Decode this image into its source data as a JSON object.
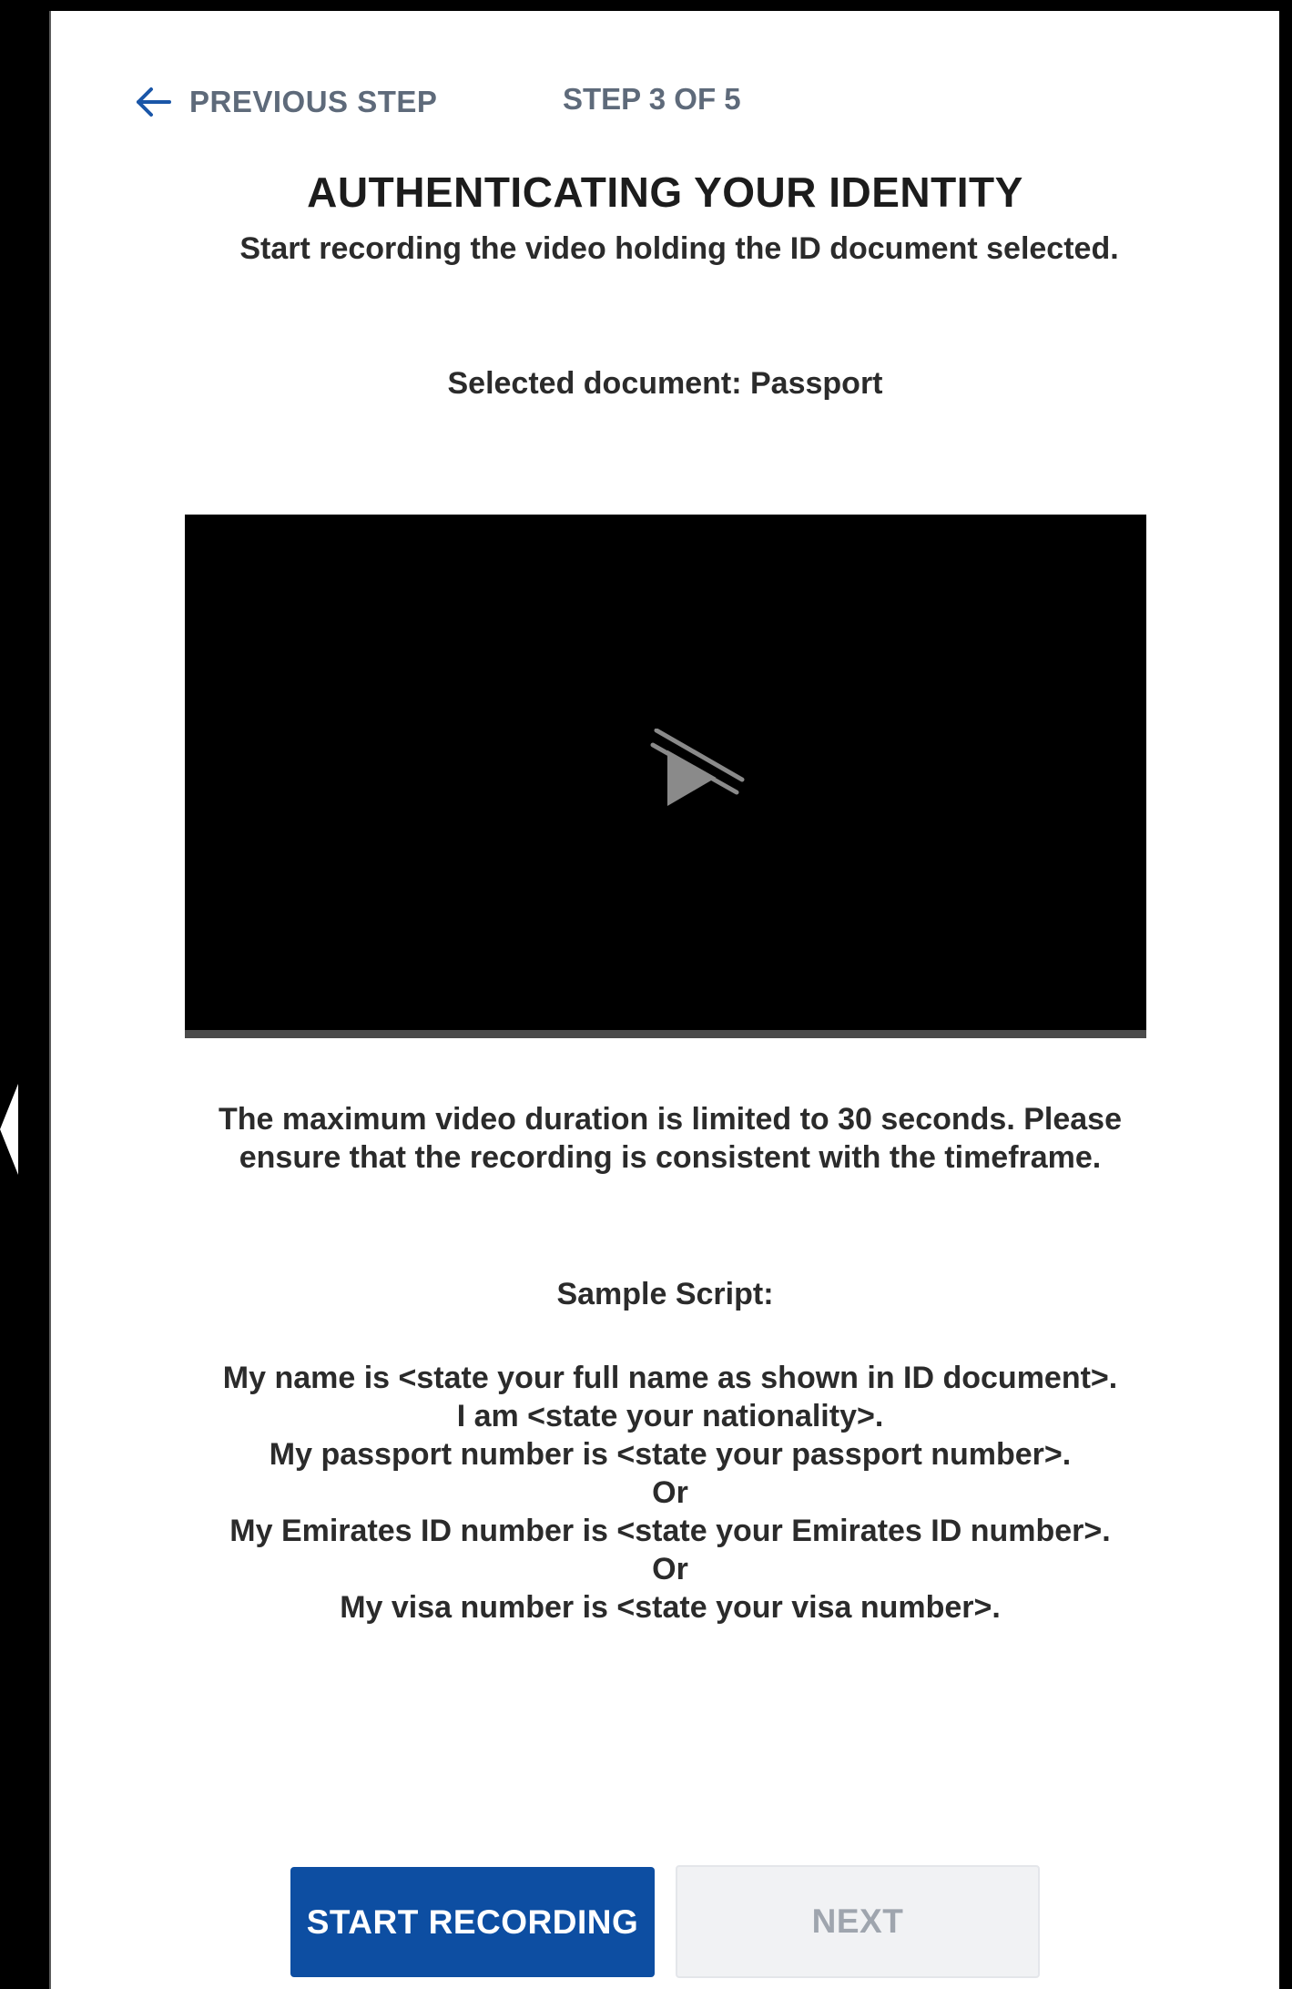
{
  "nav": {
    "previous_label": "PREVIOUS STEP",
    "step_label": "STEP 3 OF 5"
  },
  "header": {
    "title": "AUTHENTICATING YOUR IDENTITY",
    "subtitle": "Start recording the video holding the ID document selected.",
    "selected_document": "Selected document: Passport"
  },
  "video": {
    "icon": "play-disabled-icon"
  },
  "notes": {
    "duration": "The maximum video duration is limited to 30 seconds. Please ensure that the recording is consistent with the timeframe."
  },
  "sample_script": {
    "heading": "Sample Script:",
    "lines": [
      "My name is <state your full name as shown in ID document>.",
      "I am <state your nationality>.",
      "My passport number is <state your passport number>.",
      "Or",
      "My Emirates ID number is <state your Emirates ID number>.",
      "Or",
      "My visa number is <state your visa number>."
    ]
  },
  "buttons": {
    "start_recording": "START RECORDING",
    "next": "NEXT"
  },
  "colors": {
    "primary": "#0d4ea2",
    "muted_text": "#5e6a7a",
    "disabled_bg": "#f1f2f4",
    "disabled_text": "#9fa5ae"
  }
}
